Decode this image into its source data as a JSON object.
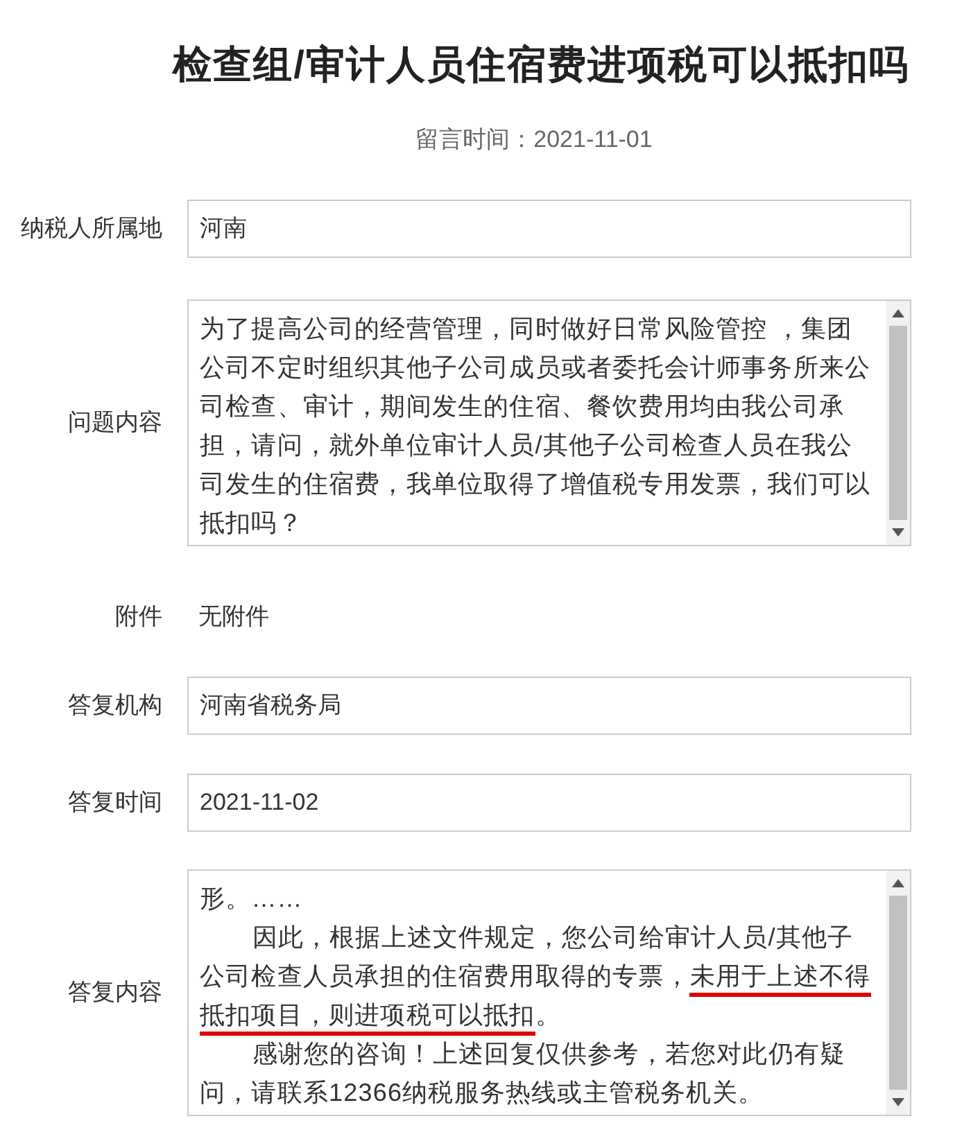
{
  "title": "检查组/审计人员住宿费进项税可以抵扣吗",
  "message_time": "留言时间：2021-11-01",
  "fields": [
    {
      "kind": "input",
      "label": "纳税人所属地",
      "value": "河南"
    },
    {
      "kind": "textarea",
      "label": "问题内容",
      "paragraphs": [
        {
          "indent": false,
          "segments": [
            {
              "text": "为了提高公司的经营管理，同时做好日常风险管控 ，集团公司不定时组织其他子公司成员或者委托会计师事务所来公司检查、审计，期间发生的住宿、餐饮费用均由我公司承担，请问，就外单位审计人员/其他子公司检查人员在我公司发生的住宿费，我单位取得了增值税专用发票，我们可以抵扣吗？",
              "underlined": false
            }
          ]
        }
      ]
    },
    {
      "kind": "plain",
      "label": "附件",
      "value": "无附件"
    },
    {
      "kind": "input",
      "label": "答复机构",
      "value": "河南省税务局"
    },
    {
      "kind": "input",
      "label": "答复时间",
      "value": "2021-11-02"
    },
    {
      "kind": "textarea",
      "label": "答复内容",
      "paragraphs": [
        {
          "indent": false,
          "segments": [
            {
              "text": "形。……",
              "underlined": false
            }
          ]
        },
        {
          "indent": true,
          "segments": [
            {
              "text": "因此，根据上述文件规定，您公司给审计人员/其他子公司检查人员承担的住宿费用取得的专票，",
              "underlined": false
            },
            {
              "text": "未用于上述不得抵扣项目，则进项税可以抵扣",
              "underlined": true
            },
            {
              "text": "。",
              "underlined": false
            }
          ]
        },
        {
          "indent": true,
          "segments": [
            {
              "text": "感谢您的咨询！上述回复仅供参考，若您对此仍有疑问，请联系12366纳税服务热线或主管税务机关。",
              "underlined": false
            }
          ]
        }
      ]
    }
  ]
}
